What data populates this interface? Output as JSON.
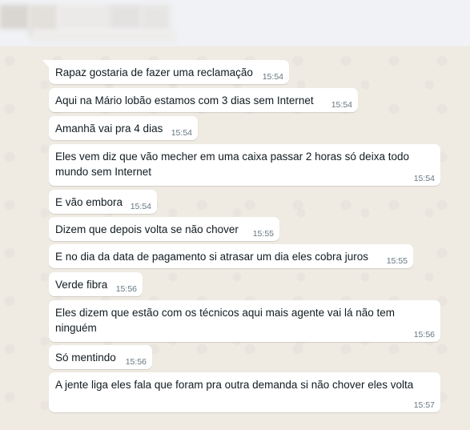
{
  "messages": [
    {
      "text": "Rapaz gostaria de fazer uma reclamação",
      "time": "15:54"
    },
    {
      "text": "Aqui na Mário lobão estamos com 3 dias sem Internet",
      "time": "15:54"
    },
    {
      "text": "Amanhã vai pra 4 dias",
      "time": "15:54"
    },
    {
      "text": "Eles vem diz que vão mecher em uma caixa passar 2 horas só deixa todo mundo sem Internet",
      "time": "15:54"
    },
    {
      "text": "E vão embora",
      "time": "15:54"
    },
    {
      "text": "Dizem que depois volta se não chover",
      "time": "15:55"
    },
    {
      "text": "E no dia da data de pagamento si atrasar um dia eles cobra juros",
      "time": "15:55"
    },
    {
      "text": "Verde fibra",
      "time": "15:56"
    },
    {
      "text": "Eles dizem que estão com os técnicos aqui mais agente vai lá não tem ninguém",
      "time": "15:56"
    },
    {
      "text": "Só mentindo",
      "time": "15:56"
    },
    {
      "text": "A jente liga eles fala que foram pra outra demanda si não chover eles volta",
      "time": "15:57"
    }
  ],
  "colors": {
    "chat_background": "#efeae2",
    "bubble": "#ffffff",
    "text": "#111b21",
    "timestamp": "#667781"
  }
}
